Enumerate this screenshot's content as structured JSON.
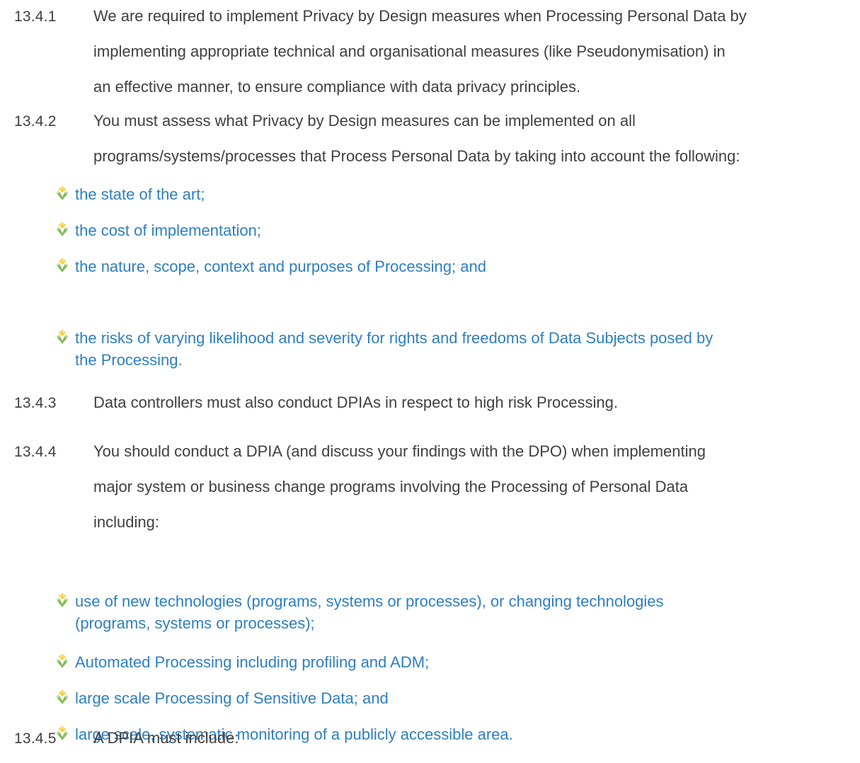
{
  "clauses": [
    {
      "number": "13.4.1",
      "lines": [
        "We are required to implement Privacy by Design measures when Processing Personal Data by",
        "implementing appropriate technical and organisational measures (like Pseudonymisation) in",
        "an effective manner, to ensure compliance with data privacy principles."
      ]
    },
    {
      "number": "13.4.2",
      "lines": [
        "You must assess what Privacy by Design measures can be implemented on all",
        "programs/systems/processes that Process Personal Data by taking into account the following:"
      ],
      "bullets": [
        [
          "the state of the art;"
        ],
        [
          "the cost of implementation;"
        ],
        [
          "the nature, scope, context and purposes of Processing; and"
        ],
        [
          "the risks of varying likelihood and severity for rights and freedoms of Data Subjects posed by",
          "the Processing."
        ]
      ]
    },
    {
      "number": "13.4.3",
      "lines": [
        "Data controllers must also conduct DPIAs in respect to high risk Processing."
      ]
    },
    {
      "number": "13.4.4",
      "lines": [
        "You should conduct a DPIA (and discuss your findings with the DPO) when implementing",
        "major system or business change programs involving the Processing of Personal Data",
        "including:"
      ],
      "bullets": [
        [
          "use of new technologies (programs, systems or processes), or changing technologies",
          "(programs, systems or processes);"
        ],
        [
          "Automated Processing including profiling and ADM;"
        ],
        [
          "large scale Processing of Sensitive Data; and"
        ],
        [
          "large scale, systematic monitoring of a publicly accessible area."
        ]
      ]
    },
    {
      "number": "13.4.5",
      "lines": [
        "A DPIA must include:"
      ]
    }
  ],
  "colors": {
    "body_text": "#404040",
    "bullet_text": "#2e7fc0"
  },
  "icons": {
    "bullet": "flower-bullet-icon"
  }
}
